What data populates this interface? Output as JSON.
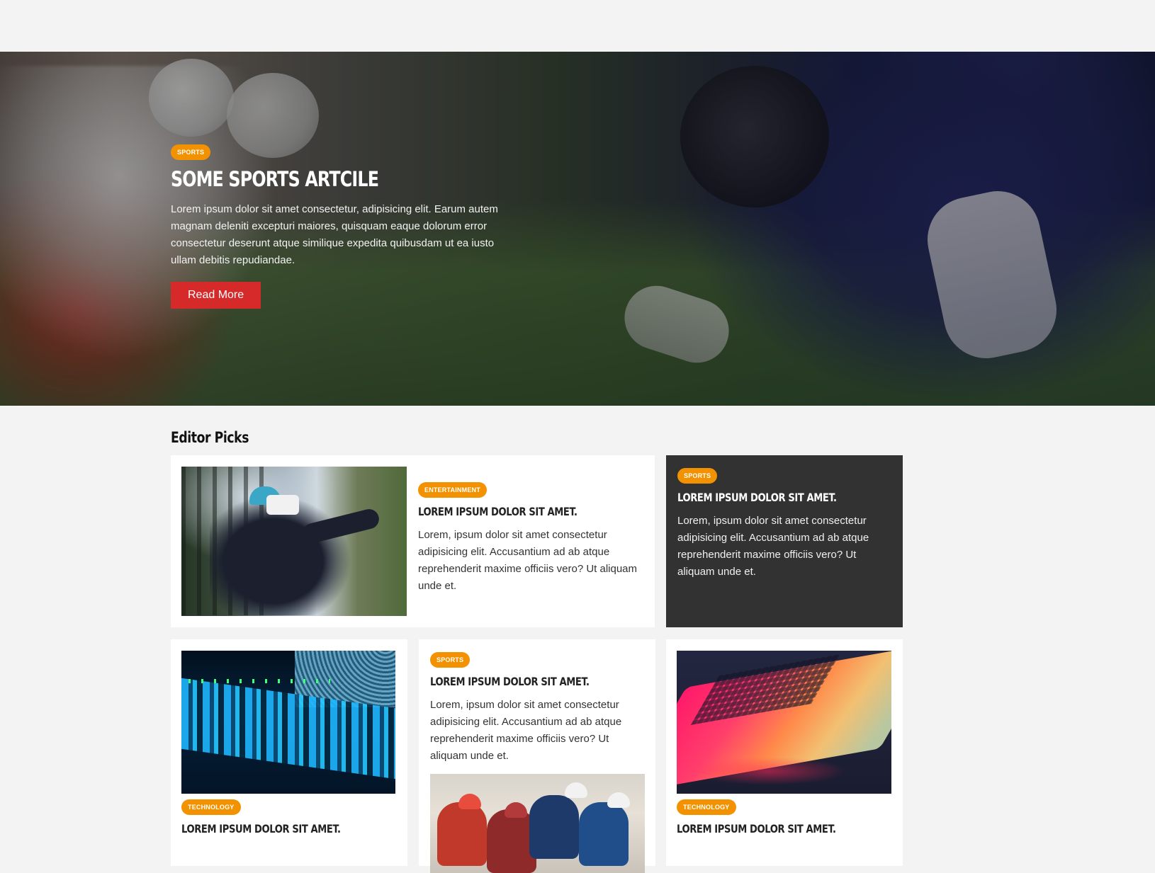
{
  "colors": {
    "accent_badge": "#f39200",
    "read_more": "#d62a2a",
    "dark_card": "#323232",
    "page_bg": "#f3f3f3"
  },
  "hero": {
    "badge": "Sports",
    "title": "Some Sports Artcile",
    "text": "Lorem ipsum dolor sit amet consectetur, adipisicing elit. Earum autem magnam deleniti excepturi maiores, quisquam eaque dolorum error consectetur deserunt atque similique expedita quibusdam ut ea iusto ullam debitis repudiandae.",
    "button": "Read More"
  },
  "editor_picks": {
    "title": "Editor Picks",
    "cards": [
      {
        "badge": "Entertainment",
        "title": "Lorem ipsum dolor sit amet.",
        "text": "Lorem, ipsum dolor sit amet consectetur adipisicing elit. Accusantium ad ab atque reprehenderit maxime officiis vero? Ut aliquam unde et.",
        "image": "vr-headset-photo"
      },
      {
        "badge": "Sports",
        "title": "Lorem ipsum dolor sit amet.",
        "text": "Lorem, ipsum dolor sit amet consectetur adipisicing elit. Accusantium ad ab atque reprehenderit maxime officiis vero? Ut aliquam unde et."
      },
      {
        "badge": "Technology",
        "title": "Lorem ipsum dolor sit amet.",
        "image": "server-rack-photo"
      },
      {
        "badge": "Sports",
        "title": "Lorem ipsum dolor sit amet.",
        "text": "Lorem, ipsum dolor sit amet consectetur adipisicing elit. Accusantium ad ab atque reprehenderit maxime officiis vero? Ut aliquam unde et.",
        "image": "cyclists-photo"
      },
      {
        "badge": "Technology",
        "title": "Lorem ipsum dolor sit amet.",
        "image": "rgb-laptop-photo"
      }
    ]
  }
}
